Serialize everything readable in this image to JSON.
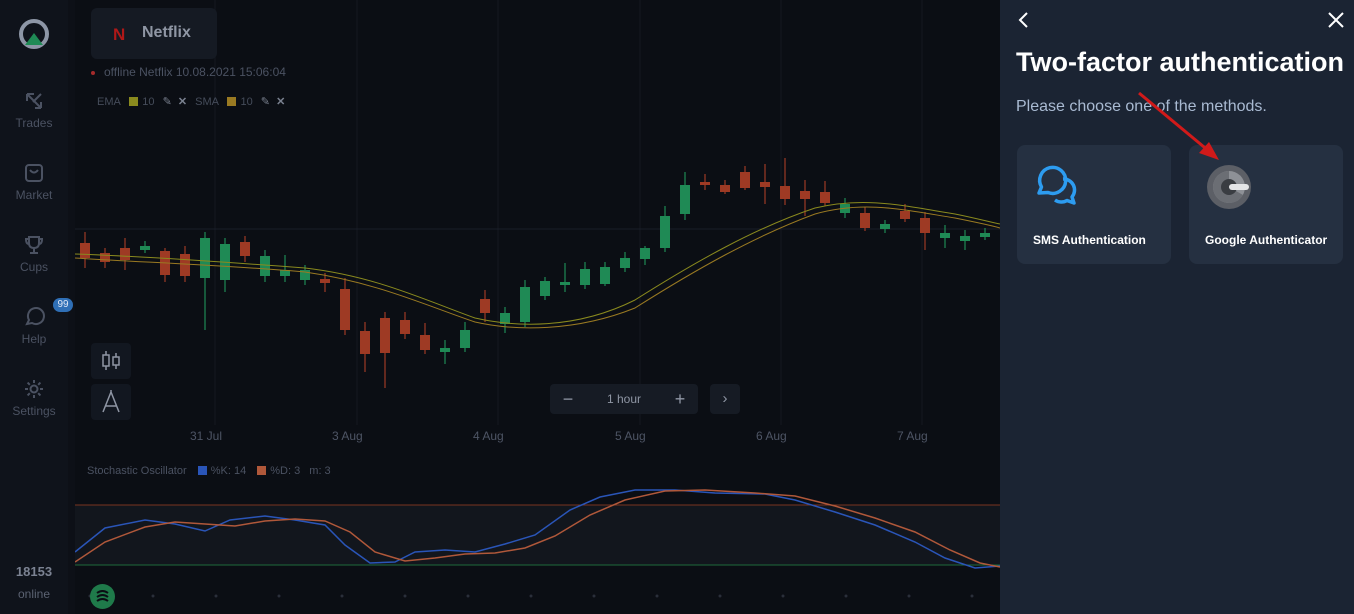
{
  "sidebar": {
    "items": [
      {
        "label": "Trades",
        "icon": "trades-arrows-icon"
      },
      {
        "label": "Market",
        "icon": "market-bag-icon"
      },
      {
        "label": "Cups",
        "icon": "cup-trophy-icon"
      },
      {
        "label": "Help",
        "icon": "help-chat-icon",
        "badge": "99"
      },
      {
        "label": "Settings",
        "icon": "gear-icon"
      }
    ],
    "online_count": "18153",
    "online_label": "online"
  },
  "asset": {
    "logo": "N",
    "name": "Netflix",
    "status": "offline Netflix 10.08.2021 15:06:04"
  },
  "indicators": {
    "ema_label": "EMA",
    "ema_period": "10",
    "ema_color": "#8a8a1e",
    "sma_label": "SMA",
    "sma_period": "10",
    "sma_color": "#9a7a22"
  },
  "timeframe": {
    "minus": "−",
    "label": "1 hour",
    "plus": "+",
    "next": "›"
  },
  "dates": [
    "31 Jul",
    "3 Aug",
    "4 Aug",
    "5 Aug",
    "6 Aug",
    "7 Aug"
  ],
  "oscillator": {
    "name": "Stochastic Oscillator",
    "k_label": "%K: 14",
    "d_label": "%D: 3",
    "m_label": "m: 3",
    "k_color": "#2a55b8",
    "d_color": "#b0583a"
  },
  "colors": {
    "up": "#1f8a55",
    "down": "#9e3a24",
    "panel_bg": "#1b2433",
    "card_bg": "#253041",
    "sms_icon": "#2d9cf0",
    "annotation_arrow": "#d11a1a"
  },
  "panel": {
    "title": "Two-factor authentication",
    "subtitle": "Please choose one of the methods.",
    "methods": [
      {
        "label": "SMS Authentication",
        "icon": "chat-bubbles-icon"
      },
      {
        "label": "Google Authenticator",
        "icon": "google-authenticator-icon"
      }
    ]
  }
}
